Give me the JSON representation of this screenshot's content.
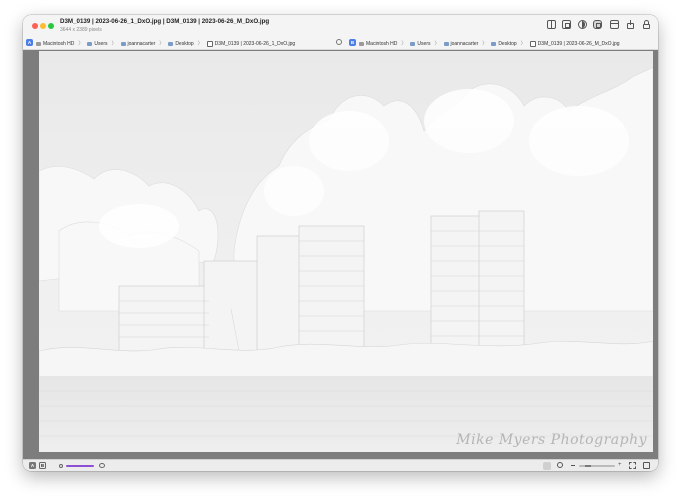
{
  "window": {
    "title": "D3M_0139 | 2023-06-26_1_DxO.jpg | D3M_0139 | 2023-06-26_M_DxO.jpg",
    "subtitle": "3644 x 2389 pixels"
  },
  "toolbar_icons": [
    "sidebar-icon",
    "copy-icon",
    "compare-icon",
    "overlay-icon",
    "window-icon",
    "export-icon",
    "lock-icon"
  ],
  "left_path": {
    "badge": "A",
    "crumbs": [
      "Macintosh HD",
      "Users",
      "joannacarter",
      "Desktop",
      "D3M_0139 | 2023-06-26_1_DxO.jpg"
    ]
  },
  "right_path": {
    "badge": "B",
    "crumbs": [
      "Macintosh HD",
      "Users",
      "joannacarter",
      "Desktop",
      "D3M_0139 | 2023-06-26_M_DxO.jpg"
    ]
  },
  "photo": {
    "watermark": "Mike Myers Photography"
  },
  "bottombar": {
    "a_label": "A",
    "b_label": "B",
    "slider_accent": "#8e4fd1"
  }
}
